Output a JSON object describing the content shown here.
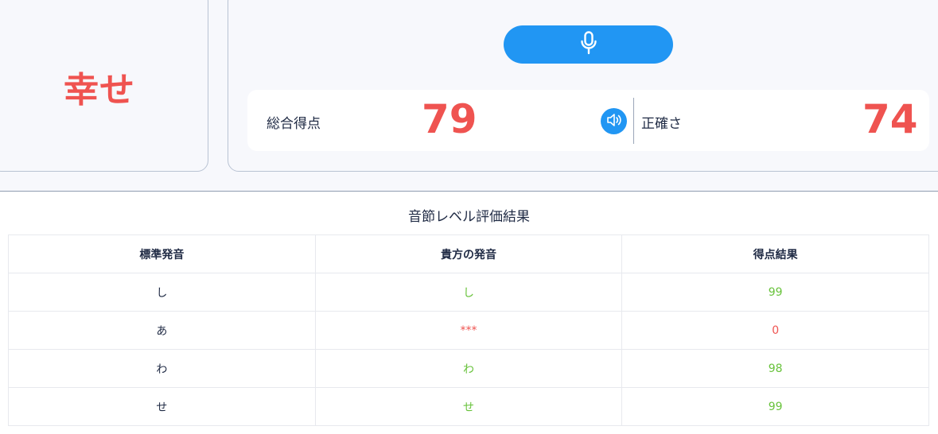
{
  "word": {
    "text": "幸せ"
  },
  "score_panel": {
    "overall_label": "総合得点",
    "overall_value": "79",
    "accuracy_label": "正確さ",
    "accuracy_value": "74"
  },
  "icons": {
    "mic": "microphone-icon",
    "speaker": "speaker-icon"
  },
  "colors": {
    "accent": "#2196f3",
    "score_red": "#ef5350",
    "good_green": "#67c23a"
  },
  "results": {
    "title": "音節レベル評価結果",
    "headers": [
      "標準発音",
      "貴方の発音",
      "得点結果"
    ],
    "rows": [
      {
        "standard": "し",
        "yours": "し",
        "score": "99",
        "status": "good"
      },
      {
        "standard": "あ",
        "yours": "***",
        "score": "0",
        "status": "bad"
      },
      {
        "standard": "わ",
        "yours": "わ",
        "score": "98",
        "status": "good"
      },
      {
        "standard": "せ",
        "yours": "せ",
        "score": "99",
        "status": "good"
      }
    ]
  }
}
